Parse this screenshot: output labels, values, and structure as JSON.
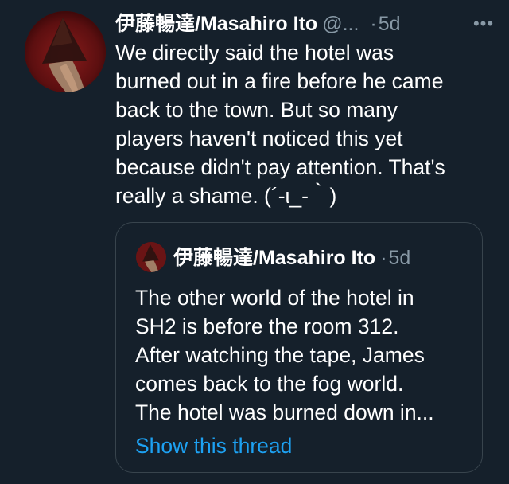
{
  "tweet": {
    "display_name": "伊藤暢達/Masahiro Ito",
    "handle": "@...",
    "dot": "·",
    "time": "5d",
    "more": "•••",
    "lines": [
      "We directly said the hotel was",
      "burned out in a fire before he came",
      "back to the town. But so many",
      "players haven't noticed this yet",
      "because didn't pay attention. That's",
      "really a shame. (´-ι_-｀)"
    ]
  },
  "quote": {
    "display_name": "伊藤暢達/Masahiro Ito",
    "dot": "·",
    "time": "5d",
    "lines": [
      "The other world of the hotel in",
      "SH2 is before the room 312.",
      "After watching the tape, James",
      "comes back to the fog world.",
      "The hotel was burned down in..."
    ],
    "show_thread": "Show this thread"
  },
  "colors": {
    "background": "#15202b",
    "text": "#ffffff",
    "secondary": "#8899a6",
    "link": "#1da1f2",
    "border": "#38444d"
  },
  "icons": {
    "avatar": "pyramid-head-avatar",
    "more": "more-options-icon"
  }
}
